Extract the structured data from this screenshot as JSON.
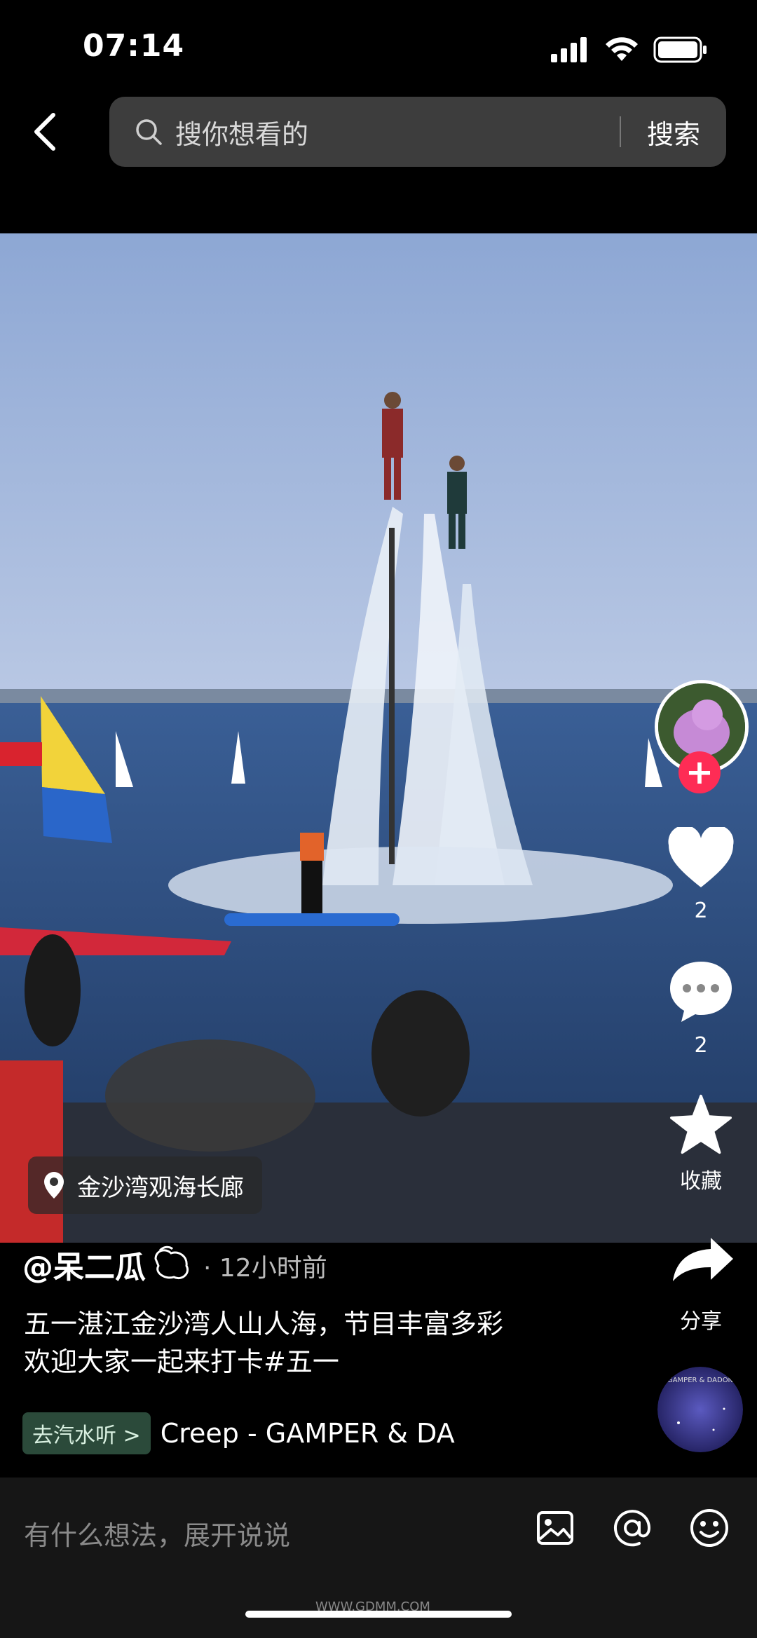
{
  "status_bar": {
    "time": "07:14"
  },
  "search": {
    "placeholder": "搜你想看的",
    "button": "搜索"
  },
  "location": {
    "text": "金沙湾观海长廊"
  },
  "rail": {
    "like_count": "2",
    "comment_count": "2",
    "favorite_label": "收藏",
    "share_label": "分享"
  },
  "post": {
    "author": "@呆二瓜",
    "time": "· 12小时前",
    "caption_line1": "五一湛江金沙湾人山人海，节目丰富多彩",
    "caption_line2": "欢迎大家一起来打卡#五一",
    "music_tag": "去汽水听 >",
    "music_title": "Creep - GAMPER & DA",
    "disc_text": "GAMPER & DADON"
  },
  "comment_bar": {
    "placeholder": "有什么想法，展开说说"
  },
  "watermark": "WWW.GDMM.COM",
  "colors": {
    "accent": "#fe2c55",
    "background": "#000000"
  }
}
